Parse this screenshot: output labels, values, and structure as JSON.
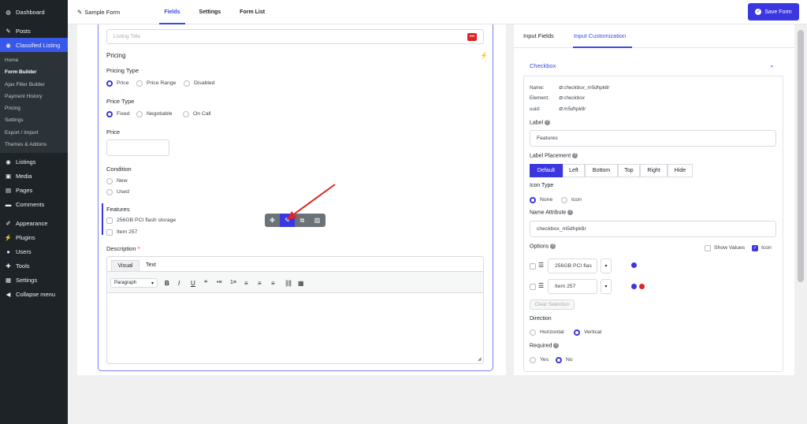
{
  "sidebar": {
    "items": [
      {
        "label": "Dashboard",
        "icon": "dashboard-icon"
      },
      {
        "label": "Posts",
        "icon": "pin-icon"
      },
      {
        "label": "Classified Listing",
        "icon": "location-icon"
      }
    ],
    "sub": [
      "Home",
      "Form Builder",
      "Ajax Filter Builder",
      "Payment History",
      "Pricing",
      "Settings",
      "Export / Import",
      "Themes & Addons"
    ],
    "lower": [
      {
        "label": "Listings",
        "icon": "location-icon"
      },
      {
        "label": "Media",
        "icon": "media-icon"
      },
      {
        "label": "Pages",
        "icon": "page-icon"
      },
      {
        "label": "Comments",
        "icon": "comment-icon"
      },
      {
        "label": "Appearance",
        "icon": "brush-icon"
      },
      {
        "label": "Plugins",
        "icon": "plug-icon"
      },
      {
        "label": "Users",
        "icon": "user-icon"
      },
      {
        "label": "Tools",
        "icon": "wrench-icon"
      },
      {
        "label": "Settings",
        "icon": "settings-icon"
      },
      {
        "label": "Collapse menu",
        "icon": "collapse-icon"
      }
    ]
  },
  "topbar": {
    "form_name": "Sample Form",
    "tabs": [
      "Fields",
      "Settings",
      "Form List"
    ],
    "save_label": "Save Form"
  },
  "form": {
    "listing_title_placeholder": "Listing Title",
    "pricing_heading": "Pricing",
    "pricing_type_label": "Pricing Type",
    "pricing_type_options": [
      "Price",
      "Price Range",
      "Disabled"
    ],
    "price_type_label": "Price Type",
    "price_type_options": [
      "Fixed",
      "Negotiable",
      "On Call"
    ],
    "price_label": "Price",
    "condition_label": "Condition",
    "condition_options": [
      "New",
      "Used"
    ],
    "features_label": "Features",
    "features_options": [
      "256GB PCI flash storage",
      "Item 257"
    ],
    "description_label": "Description",
    "required_mark": "*",
    "editor_tabs": [
      "Visual",
      "Text"
    ],
    "paragraph_select": "Paragraph",
    "editor_buttons": [
      "B",
      "I",
      "U",
      "“",
      "•≡",
      "1≡",
      "≡",
      "≡",
      "≡",
      "⛓",
      "▦"
    ]
  },
  "right": {
    "tabs": [
      "Input Fields",
      "Input Customization"
    ],
    "card_title": "Checkbox",
    "meta": [
      {
        "key": "Name:",
        "value": "checkbox_m5dhpk8r"
      },
      {
        "key": "Element:",
        "value": "checkbox"
      },
      {
        "key": "uuid:",
        "value": "m5dhpk8r"
      }
    ],
    "label_label": "Label",
    "label_value": "Features",
    "placement_label": "Label Placement",
    "placement_options": [
      "Default",
      "Left",
      "Bottom",
      "Top",
      "Right",
      "Hide"
    ],
    "icon_type_label": "Icon Type",
    "icon_type_options": [
      "None",
      "Icon"
    ],
    "name_attr_label": "Name Attribute",
    "name_attr_value": "checkbox_m5dhpk8r",
    "options_label": "Options",
    "show_values_label": "Show Values",
    "icon_label": "Icon",
    "option_rows": [
      "256GB PCI flas",
      "Item 257"
    ],
    "clear_selection": "Clear Selection",
    "direction_label": "Direction",
    "direction_options": [
      "Horizontal",
      "Vertical"
    ],
    "required_label": "Required",
    "required_options": [
      "Yes",
      "No"
    ]
  },
  "colors": {
    "accent": "#3a36e0",
    "sidebar_bg": "#1d2327",
    "active_menu": "#3858e9",
    "danger": "#e02424"
  }
}
